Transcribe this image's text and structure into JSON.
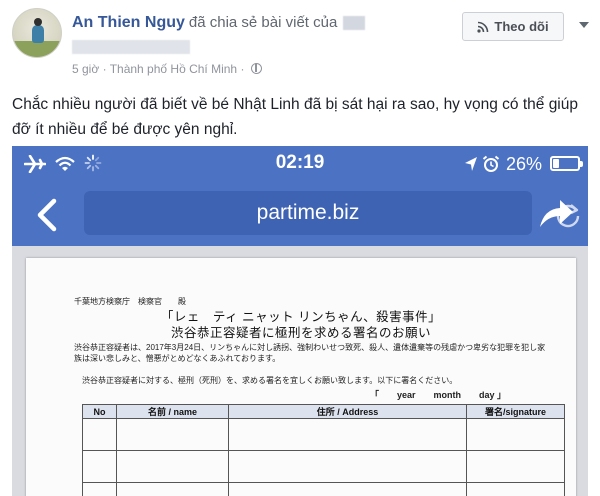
{
  "post": {
    "author": "An Thien Nguy",
    "shared_text": "đã chia sẻ bài viết của",
    "time": "5 giờ",
    "separator": "·",
    "location": "Thành phố Hồ Chí Minh",
    "dot": "·",
    "follow_label": "Theo dõi",
    "body": "Chắc nhiều người đã biết về bé Nhật Linh đã bị sát hại ra sao, hy vọng có thể giúp đỡ ít nhiều để bé được yên nghỉ."
  },
  "phone": {
    "time": "02:19",
    "battery": "26%",
    "battery_level": 0.26,
    "url": "partime.biz"
  },
  "document": {
    "addressee": "千葉地方検察庁　検察官　　殿",
    "title_line1": "「レェ　ティ ニャット リンちゃん、殺害事件」",
    "title_line2": "渋谷恭正容疑者に極刑を求める署名のお願い",
    "body": "渋谷恭正容疑者は、2017年3月24日、リンちゃんに対し誘拐、強制わいせつ致死、殺人、遺体遺棄等の残虐かつ卑劣な犯罪を犯し家族は深い悲しみと、憎悪がとめどなくあふれております。",
    "request": "渋谷恭正容疑者に対する、極刑（死刑）を、求める署名を宜しくお願い致します。以下に署名ください。",
    "date_line": "「　　year　　month　　day 」",
    "table": {
      "headers": [
        "No",
        "名前 / name",
        "住所 / Address",
        "署名/signature"
      ]
    }
  },
  "colors": {
    "link": "#365899",
    "phone_bar": "#4c72c4",
    "url_box": "#3e63b2",
    "table_header": "#dde3ee"
  }
}
